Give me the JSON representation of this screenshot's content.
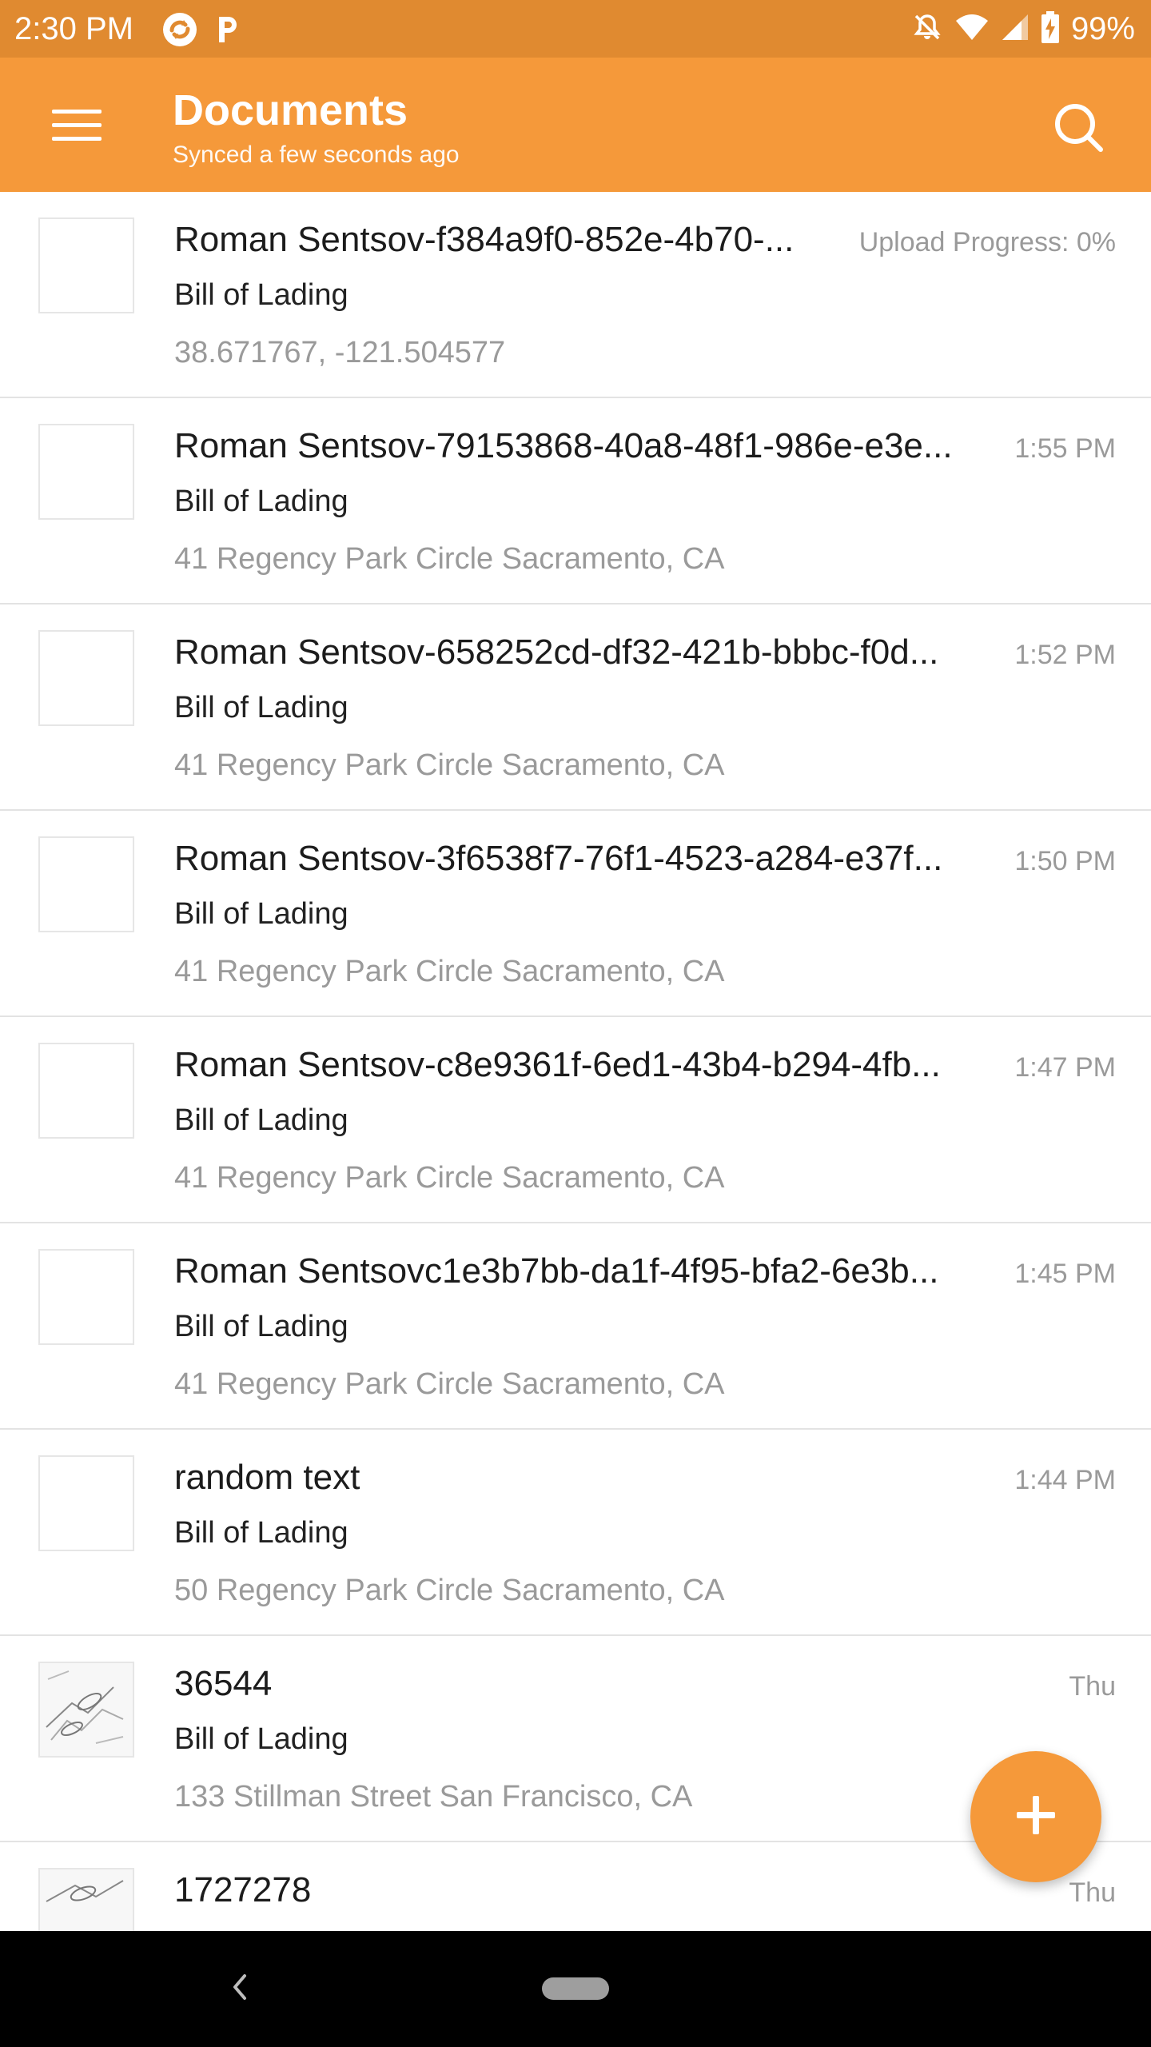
{
  "status_bar": {
    "time": "2:30 PM",
    "battery": "99%",
    "icons": [
      "sync-icon",
      "p-app-icon",
      "notifications-off-icon",
      "wifi-icon",
      "cell-signal-icon",
      "battery-charging-icon"
    ]
  },
  "app_bar": {
    "title": "Documents",
    "subtitle": "Synced a few seconds ago",
    "menu_icon": "hamburger-menu-icon",
    "search_icon": "search-icon"
  },
  "documents": [
    {
      "name": "Roman Sentsov-f384a9f0-852e-4b70-...",
      "meta": "Upload Progress: 0%",
      "type": "Bill of Lading",
      "location": "38.671767, -121.504577",
      "thumb": "blank"
    },
    {
      "name": "Roman Sentsov-79153868-40a8-48f1-986e-e3e...",
      "meta": "1:55 PM",
      "type": "Bill of Lading",
      "location": "41 Regency Park Circle Sacramento, CA",
      "thumb": "blank"
    },
    {
      "name": "Roman Sentsov-658252cd-df32-421b-bbbc-f0d...",
      "meta": "1:52 PM",
      "type": "Bill of Lading",
      "location": "41 Regency Park Circle Sacramento, CA",
      "thumb": "blank"
    },
    {
      "name": "Roman Sentsov-3f6538f7-76f1-4523-a284-e37f...",
      "meta": "1:50 PM",
      "type": "Bill of Lading",
      "location": "41 Regency Park Circle Sacramento, CA",
      "thumb": "blank"
    },
    {
      "name": "Roman Sentsov-c8e9361f-6ed1-43b4-b294-4fb...",
      "meta": "1:47 PM",
      "type": "Bill of Lading",
      "location": "41 Regency Park Circle Sacramento, CA",
      "thumb": "blank"
    },
    {
      "name": "Roman Sentsovc1e3b7bb-da1f-4f95-bfa2-6e3b...",
      "meta": "1:45 PM",
      "type": "Bill of Lading",
      "location": "41 Regency Park Circle Sacramento, CA",
      "thumb": "blank"
    },
    {
      "name": "random text",
      "meta": "1:44 PM",
      "type": "Bill of Lading",
      "location": "50 Regency Park Circle Sacramento, CA",
      "thumb": "blank"
    },
    {
      "name": "36544",
      "meta": "Thu",
      "type": "Bill of Lading",
      "location": "133 Stillman Street San Francisco, CA",
      "thumb": "sketch"
    },
    {
      "name": "1727278",
      "meta": "Thu",
      "type": "",
      "location": "",
      "thumb": "sketch"
    }
  ],
  "fab": {
    "icon": "plus-icon"
  },
  "nav_bar": {
    "back_icon": "back-chevron-icon",
    "home_icon": "home-pill-icon"
  },
  "colors": {
    "status_bar": "#E08A30",
    "app_bar": "#F5993A",
    "accent": "#F5993A",
    "secondary_text": "#9a9a9a",
    "divider": "#e3e3e3"
  }
}
